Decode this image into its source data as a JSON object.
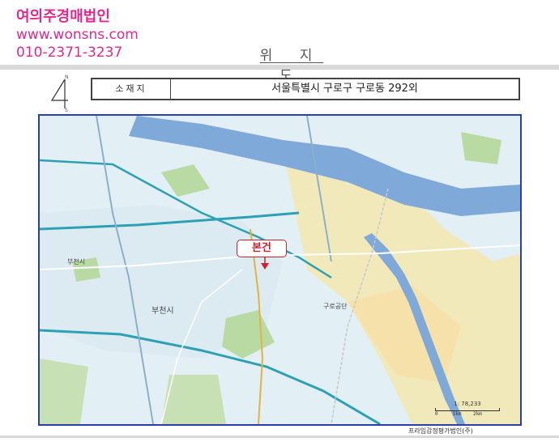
{
  "header": {
    "company": "여의주경매법인",
    "website": "www.wonsns.com",
    "phone": "010-2371-3237"
  },
  "title": "위 지 도",
  "north_arrow": {
    "top": "N",
    "bottom": "S"
  },
  "address": {
    "label": "소재지",
    "value": "서울특별시 구로구 구로동 292외"
  },
  "map": {
    "subject_label": "본건",
    "place_labels": {
      "bucheon": "부천시",
      "bucheon_bottom": "부천시",
      "guro": "구로공단"
    },
    "scale": {
      "ratio": "1: 78,233",
      "ticks": "0     1km    2km"
    },
    "colors": {
      "river": "#7fa9d8",
      "highway": "#2da1b3",
      "green": "#b9dba3",
      "urban": "#f4e8b0",
      "subject": "#d21e2e"
    }
  },
  "credit": "프라임감정평가법인(주)"
}
